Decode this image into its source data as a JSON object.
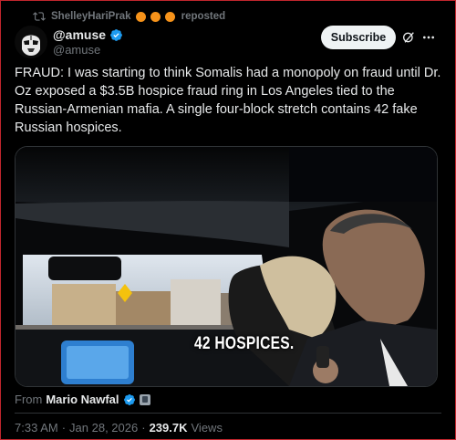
{
  "repost": {
    "user": "ShelleyHariPrak",
    "label": "reposted"
  },
  "author": {
    "display_name": "@amuse",
    "handle": "@amuse",
    "subscribe_label": "Subscribe"
  },
  "tweet": {
    "text": "FRAUD: I was starting to think Somalis had a monopoly on fraud until Dr. Oz exposed a $3.5B hospice fraud ring in Los Angeles tied to the Russian-Armenian mafia. A single four-block stretch contains 42 fake Russian hospices."
  },
  "media": {
    "caption": "42 HOSPICES."
  },
  "attribution": {
    "prefix": "From",
    "name": "Mario Nawfal"
  },
  "meta": {
    "time": "7:33 AM",
    "separator": "·",
    "date": "Jan 28, 2026",
    "views_count": "239.7K",
    "views_label": "Views"
  },
  "colors": {
    "verified_blue": "#1d9bf0",
    "repost_emoji": "#f7931a",
    "text_primary": "#e7e9ea",
    "text_secondary": "#71767b"
  }
}
